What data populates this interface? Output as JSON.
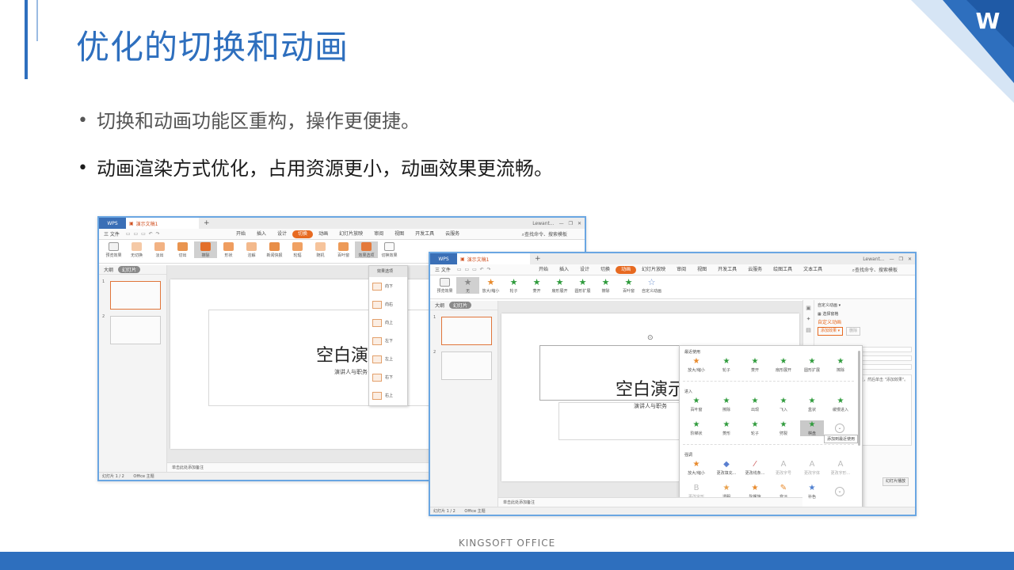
{
  "slide": {
    "title": "优化的切换和动画",
    "bullets": [
      "切换和动画功能区重构，操作更便捷。",
      "动画渲染方式优化，占用资源更小，动画效果更流畅。"
    ],
    "footer": "KINGSOFT  OFFICE",
    "logo": "W"
  },
  "colors": {
    "accent": "#2e6fbe",
    "menu_active": "#e76a21",
    "window_border": "#6aa6e2"
  },
  "win1": {
    "wps_label": "WPS",
    "doc_tab": "演示文稿1",
    "user": "Lewant...",
    "file_menu": "三 文件",
    "menus": [
      "开始",
      "插入",
      "设计",
      "切换",
      "动画",
      "幻灯片放映",
      "审阅",
      "视图",
      "开发工具",
      "云服务"
    ],
    "search": "查找命令、搜索模板",
    "ribbon": [
      {
        "label": "预览效果",
        "icon": "preview-icon"
      },
      {
        "label": "无切换"
      },
      {
        "label": "淡出"
      },
      {
        "label": "切出"
      },
      {
        "label": "擦除"
      },
      {
        "label": "形状"
      },
      {
        "label": "溶解"
      },
      {
        "label": "新闻快报"
      },
      {
        "label": "轮辐"
      },
      {
        "label": "随机"
      },
      {
        "label": "百叶窗"
      },
      {
        "label": "效果选项"
      },
      {
        "label": "切换效果"
      }
    ],
    "left_tabs": [
      "大纲",
      "幻灯片"
    ],
    "slide_numbers": [
      "1",
      "2"
    ],
    "slide_title": "空白演示",
    "slide_subtitle": "演讲人与职务",
    "notes": "单击此处添加备注",
    "status": [
      "幻灯片 1 / 2",
      "Office 主题"
    ],
    "dropdown": {
      "header": "效果选项",
      "items": [
        "向下",
        "向右",
        "向上",
        "左下",
        "左上",
        "右下",
        "右上"
      ]
    }
  },
  "win2": {
    "wps_label": "WPS",
    "doc_tab": "演示文稿1",
    "user": "Lewant...",
    "file_menu": "三 文件",
    "menus": [
      "开始",
      "插入",
      "设计",
      "切换",
      "动画",
      "幻灯片放映",
      "审阅",
      "视图",
      "开发工具",
      "云服务",
      "绘图工具",
      "文本工具"
    ],
    "search": "查找命令、搜索模板",
    "ribbon": [
      {
        "label": "预览效果"
      },
      {
        "label": "无"
      },
      {
        "label": "放大/缩小"
      },
      {
        "label": "轮子"
      },
      {
        "label": "菱开"
      },
      {
        "label": "扇形展开"
      },
      {
        "label": "圆形扩展"
      },
      {
        "label": "擦除"
      },
      {
        "label": "百叶窗"
      },
      {
        "label": "自定义动画"
      }
    ],
    "left_tabs": [
      "大纲",
      "幻灯片"
    ],
    "slide_numbers": [
      "1",
      "2"
    ],
    "slide_title": "空白演示",
    "slide_subtitle": "演讲人与职务",
    "notes": "单击此处添加备注",
    "status": [
      "幻灯片 1 / 2",
      "Office 主题"
    ],
    "taskpane": {
      "title": "自定义动画 ▾",
      "select_pane": "选择窗格",
      "custom_anim": "自定义动画",
      "add_effect": "添加效果 ▾",
      "delete": "删除",
      "hint": "片元素，然后单击 \"添加效果\"。",
      "autopreview": "幻灯片播放"
    },
    "gallery": {
      "recent_label": "最近使用",
      "recent": [
        "放大/缩小",
        "轮子",
        "菱开",
        "扇形展开",
        "圆形扩展",
        "擦除"
      ],
      "enter_label": "进入",
      "enter_row1": [
        "百叶窗",
        "擦除",
        "出现",
        "飞入",
        "盒状",
        "缓慢进入"
      ],
      "enter_row2": [
        "阶梯状",
        "菱形",
        "轮子",
        "劈裂",
        "棋盘"
      ],
      "tooltip": "添加到最近使用",
      "emph_label": "强调",
      "emph_row1": [
        "放大/缩小",
        "更改填充...",
        "更改线条...",
        "更改字号",
        "更改字体",
        "更改字形..."
      ],
      "emph_row2": [
        "更改字形",
        "透明",
        "陀螺旋",
        "变淡",
        "补色"
      ]
    }
  }
}
